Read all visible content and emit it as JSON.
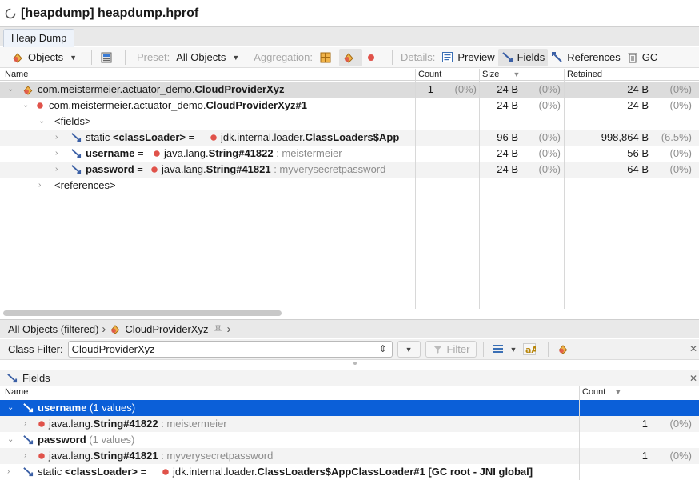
{
  "window": {
    "title": "[heapdump] heapdump.hprof"
  },
  "tab": {
    "label": "Heap Dump"
  },
  "toolbar": {
    "objects": "Objects",
    "preset_label": "Preset:",
    "preset_value": "All Objects",
    "aggregation_label": "Aggregation:",
    "details_label": "Details:",
    "preview": "Preview",
    "fields": "Fields",
    "references": "References",
    "gc": "GC"
  },
  "table": {
    "headers": {
      "name": "Name",
      "count": "Count",
      "size": "Size",
      "retained": "Retained"
    },
    "rows": [
      {
        "name_pre": "com.meistermeier.actuator_demo.",
        "name_bold": "CloudProviderXyz",
        "count": "1",
        "count_pct": "(0%)",
        "size": "24 B",
        "size_pct": "(0%)",
        "retained": "24 B",
        "retained_pct": "(0%)"
      },
      {
        "name_pre": "com.meistermeier.actuator_demo.",
        "name_bold": "CloudProviderXyz#1",
        "size": "24 B",
        "size_pct": "(0%)",
        "retained": "24 B",
        "retained_pct": "(0%)"
      },
      {
        "name": "<fields>"
      },
      {
        "static": "static ",
        "field": "<classLoader>",
        "eq": " = ",
        "type_pre": "jdk.internal.loader.",
        "type_bold": "ClassLoaders$App",
        "size": "96 B",
        "size_pct": "(0%)",
        "retained": "998,864 B",
        "retained_pct": "(6.5%)"
      },
      {
        "field": "username",
        "eq": " = ",
        "type_pre": "java.lang.",
        "type_bold": "String#41822",
        "value": " : meistermeier",
        "size": "24 B",
        "size_pct": "(0%)",
        "retained": "56 B",
        "retained_pct": "(0%)"
      },
      {
        "field": "password",
        "eq": " = ",
        "type_pre": "java.lang.",
        "type_bold": "String#41821",
        "value": " : myverysecretpassword",
        "size": "24 B",
        "size_pct": "(0%)",
        "retained": "64 B",
        "retained_pct": "(0%)"
      },
      {
        "name": "<references>"
      }
    ]
  },
  "breadcrumb": {
    "root": "All Objects (filtered)",
    "item": "CloudProviderXyz"
  },
  "filter": {
    "label": "Class Filter:",
    "value": "CloudProviderXyz",
    "button": "Filter"
  },
  "fields_panel": {
    "title": "Fields",
    "headers": {
      "name": "Name",
      "count": "Count"
    },
    "rows": [
      {
        "field": "username",
        "values": " (1 values)"
      },
      {
        "type_pre": "java.lang.",
        "type_bold": "String#41822",
        "value": " : meistermeier",
        "count": "1",
        "count_pct": "(0%)"
      },
      {
        "field": "password",
        "values": " (1 values)"
      },
      {
        "type_pre": "java.lang.",
        "type_bold": "String#41821",
        "value": " : myverysecretpassword",
        "count": "1",
        "count_pct": "(0%)"
      },
      {
        "static": "static ",
        "field": "<classLoader>",
        "eq": " = ",
        "type_pre": "jdk.internal.loader.",
        "type_bold": "ClassLoaders$AppClassLoader#1",
        "suffix": " [GC root - JNI global]"
      }
    ]
  },
  "colors": {
    "selection": "#0b5fd8",
    "instance_dot": "#e0524a",
    "class_icon": "#e8a23a"
  }
}
